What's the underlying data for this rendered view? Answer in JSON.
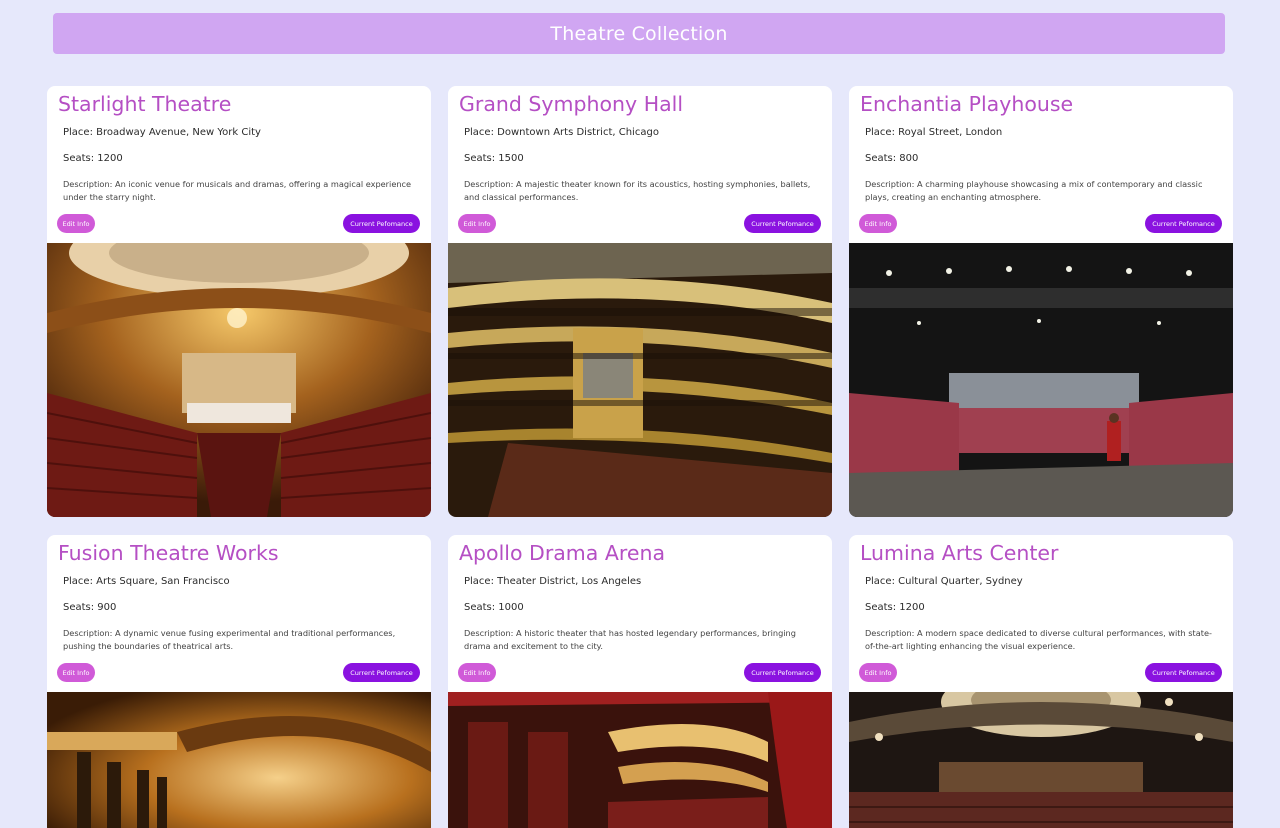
{
  "page": {
    "title": "Theatre Collection"
  },
  "colors": {
    "background": "#e6e8fb",
    "header": "#d0a6f2",
    "card_title": "#b54fc4",
    "edit_button": "#d05ad8",
    "performance_button": "#8a12e0"
  },
  "theatres": [
    {
      "name": "Starlight Theatre",
      "place": "Place: Broadway Avenue, New York City",
      "seats": "Seats: 1200",
      "description": "Description: An iconic venue for musicals and dramas, offering a magical experience under the starry night.",
      "edit_label": "Edit Info",
      "performance_label": "Current Pefomance",
      "image": "ornate-theatre-auditorium-gold-dome"
    },
    {
      "name": "Grand Symphony Hall",
      "place": "Place: Downtown Arts District, Chicago",
      "seats": "Seats: 1500",
      "description": "Description: A majestic theater known for its acoustics, hosting symphonies, ballets, and classical performances.",
      "edit_label": "Edit Info",
      "performance_label": "Current Pefomance",
      "image": "opera-house-balconies-gold-tiers"
    },
    {
      "name": "Enchantia Playhouse",
      "place": "Place: Royal Street, London",
      "seats": "Seats: 800",
      "description": "Description: A charming playhouse showcasing a mix of contemporary and classic plays, creating an enchanting atmosphere.",
      "edit_label": "Edit Info",
      "performance_label": "Current Pefomance",
      "image": "modern-black-box-theatre-red-seats"
    },
    {
      "name": "Fusion Theatre Works",
      "place": "Place: Arts Square, San Francisco",
      "seats": "Seats: 900",
      "description": "Description: A dynamic venue fusing experimental and traditional performances, pushing the boundaries of theatrical arts.",
      "edit_label": "Edit Info",
      "performance_label": "Current Pefomance",
      "image": "golden-theatre-boxes-interior"
    },
    {
      "name": "Apollo Drama Arena",
      "place": "Place: Theater District, Los Angeles",
      "seats": "Seats: 1000",
      "description": "Description: A historic theater that has hosted legendary performances, bringing drama and excitement to the city.",
      "edit_label": "Edit Info",
      "performance_label": "Current Pefomance",
      "image": "red-curtain-theatre-balconies"
    },
    {
      "name": "Lumina Arts Center",
      "place": "Place: Cultural Quarter, Sydney",
      "seats": "Seats: 1200",
      "description": "Description: A modern space dedicated to diverse cultural performances, with state-of-the-art lighting enhancing the visual experience.",
      "edit_label": "Edit Info",
      "performance_label": "Current Pefomance",
      "image": "dark-ornate-theatre-ceiling"
    }
  ]
}
